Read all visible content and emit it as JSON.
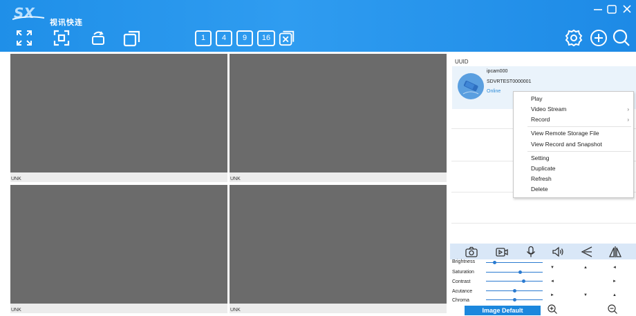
{
  "app": {
    "title": "视讯快连",
    "logo_text": "SX",
    "accent_color": "#1f8fe8"
  },
  "window_controls": [
    "minimize-icon",
    "maximize-icon",
    "close-icon"
  ],
  "toolbar": {
    "left_icons": [
      "fullscreen-icon",
      "focus-icon",
      "rotate-icon",
      "window-copy-icon"
    ],
    "layouts": [
      "1",
      "4",
      "9",
      "16"
    ],
    "right_icons": [
      "settings-icon",
      "add-icon",
      "search-icon"
    ]
  },
  "grid": {
    "panes": [
      {
        "label": "UNK"
      },
      {
        "label": "UNK"
      },
      {
        "label": "UNK"
      },
      {
        "label": "UNK"
      }
    ]
  },
  "panel": {
    "uuid_label": "UUID",
    "device": {
      "name": "ipcam000",
      "id": "SDVRTEST0000001",
      "status": "Online",
      "status_color": "#2a8ad8"
    }
  },
  "context_menu": {
    "items": [
      {
        "label": "Play",
        "submenu": false
      },
      {
        "label": "Video Stream",
        "submenu": true
      },
      {
        "label": "Record",
        "submenu": true
      },
      {
        "label": "View Remote Storage File",
        "submenu": false
      },
      {
        "label": "View Record and Snapshot",
        "submenu": false
      },
      {
        "label": "Setting",
        "submenu": false
      },
      {
        "label": "Duplicate",
        "submenu": false
      },
      {
        "label": "Refresh",
        "submenu": false
      },
      {
        "label": "Delete",
        "submenu": false
      }
    ]
  },
  "controls": {
    "icons": [
      "camera-icon",
      "record-icon",
      "microphone-icon",
      "speaker-icon",
      "flip-vertical-icon",
      "mirror-icon"
    ],
    "sliders": [
      {
        "label": "Brightness",
        "value": 0.15
      },
      {
        "label": "Saturation",
        "value": 0.6
      },
      {
        "label": "Contrast",
        "value": 0.66
      },
      {
        "label": "Acutance",
        "value": 0.5
      },
      {
        "label": "Chroma",
        "value": 0.5
      }
    ],
    "image_default_label": "Image Default",
    "zoom_icons": [
      "zoom-in-icon",
      "zoom-out-icon"
    ]
  }
}
